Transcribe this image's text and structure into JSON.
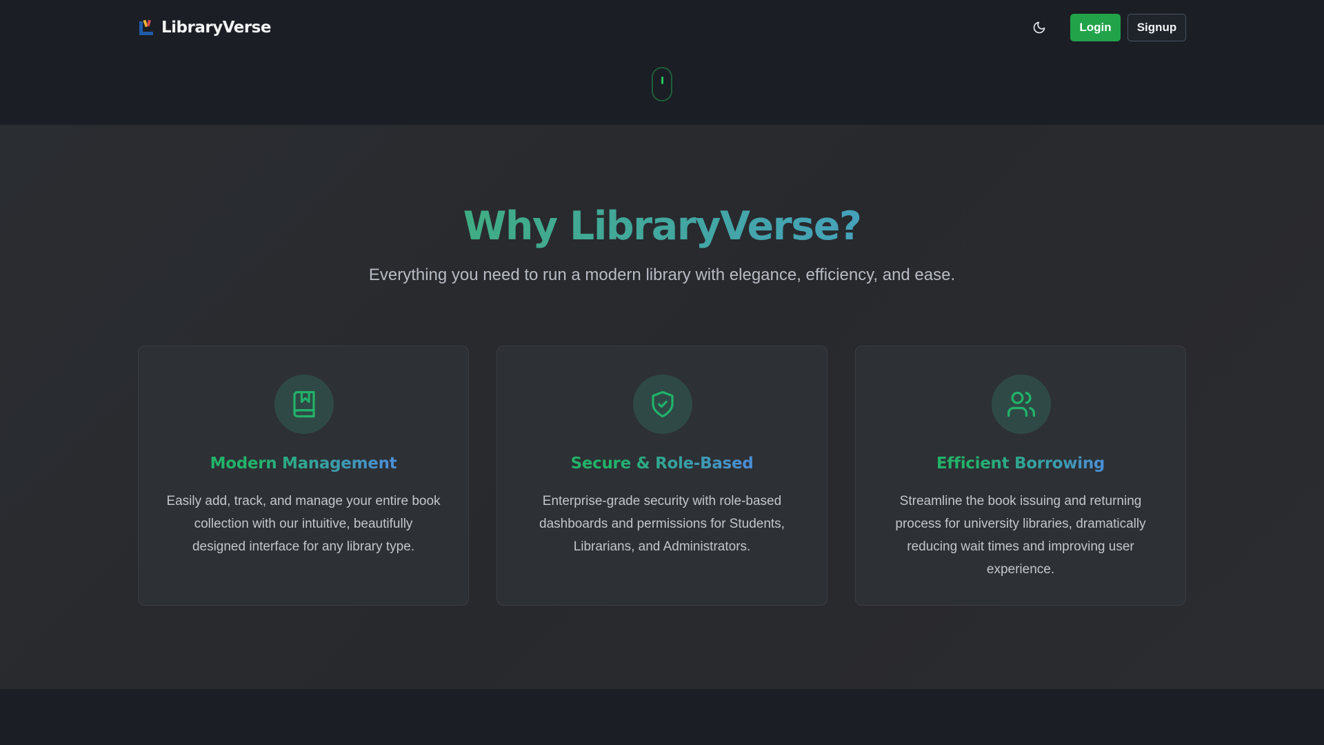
{
  "navbar": {
    "brand_name": "LibraryVerse",
    "login_label": "Login",
    "signup_label": "Signup"
  },
  "features": {
    "title": "Why LibraryVerse?",
    "subtitle": "Everything you need to run a modern library with elegance, efficiency, and ease.",
    "cards": [
      {
        "icon": "book-bookmark-icon",
        "title": "Modern Management",
        "text": "Easily add, track, and manage your entire book collection with our intuitive, beautifully designed interface for any library type."
      },
      {
        "icon": "shield-check-icon",
        "title": "Secure & Role-Based",
        "text": "Enterprise-grade security with role-based dashboards and permissions for Students, Librarians, and Administrators."
      },
      {
        "icon": "users-icon",
        "title": "Efficient Borrowing",
        "text": "Streamline the book issuing and returning process for university libraries, dramatically reducing wait times and improving user experience."
      }
    ]
  },
  "colors": {
    "background": "#1b1e24",
    "section_background": "#2a2d31",
    "accent_green": "#22a34a",
    "accent_blue": "#4a8fd6"
  }
}
